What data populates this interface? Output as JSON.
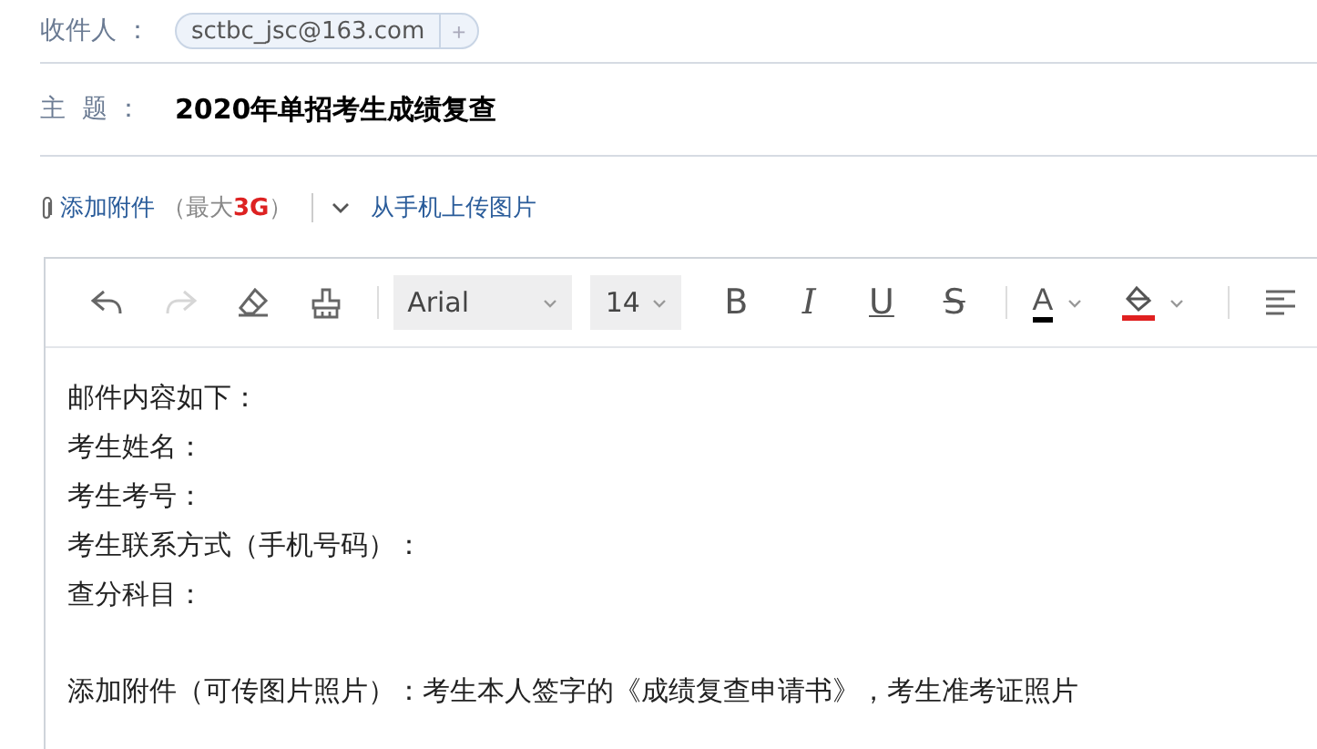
{
  "recipients": {
    "label": "收件人 ：",
    "chips": [
      "sctbc_jsc@163.com"
    ],
    "add": "+"
  },
  "subject": {
    "label": "主  题 ：",
    "value": "2020年单招考生成绩复查"
  },
  "attachments": {
    "link": "添加附件",
    "limit": "（最大**3G**）",
    "phone_upload": "从手机上传图片"
  },
  "toolbar": [
    {
      "kind": "undo",
      "disabled": false
    },
    {
      "kind": "redo",
      "disabled": true
    },
    {
      "kind": "eraser",
      "disabled": false
    },
    {
      "kind": "brush",
      "disabled": false
    },
    {
      "kind": "divider"
    },
    {
      "kind": "font_select",
      "value": "Arial"
    },
    {
      "kind": "size_select",
      "value": "14"
    },
    {
      "kind": "bold",
      "label": "B"
    },
    {
      "kind": "italic",
      "label": "I"
    },
    {
      "kind": "underline",
      "label": "U"
    },
    {
      "kind": "strike",
      "label": "S"
    },
    {
      "kind": "divider"
    },
    {
      "kind": "fontcolor",
      "label": "A",
      "color": "#000000"
    },
    {
      "kind": "highlight",
      "color": "#e02020"
    },
    {
      "kind": "divider"
    },
    {
      "kind": "align"
    }
  ],
  "body": [
    {
      "lines": [
        "邮件内容如下：",
        "考生姓名：",
        "考生考号：",
        "考生联系方式（手机号码）：",
        "查分科目："
      ]
    },
    {
      "lines": [
        "添加附件（可传图片照片）：考生本人签字的《成绩复查申请书》，考生准考证照片"
      ]
    }
  ]
}
